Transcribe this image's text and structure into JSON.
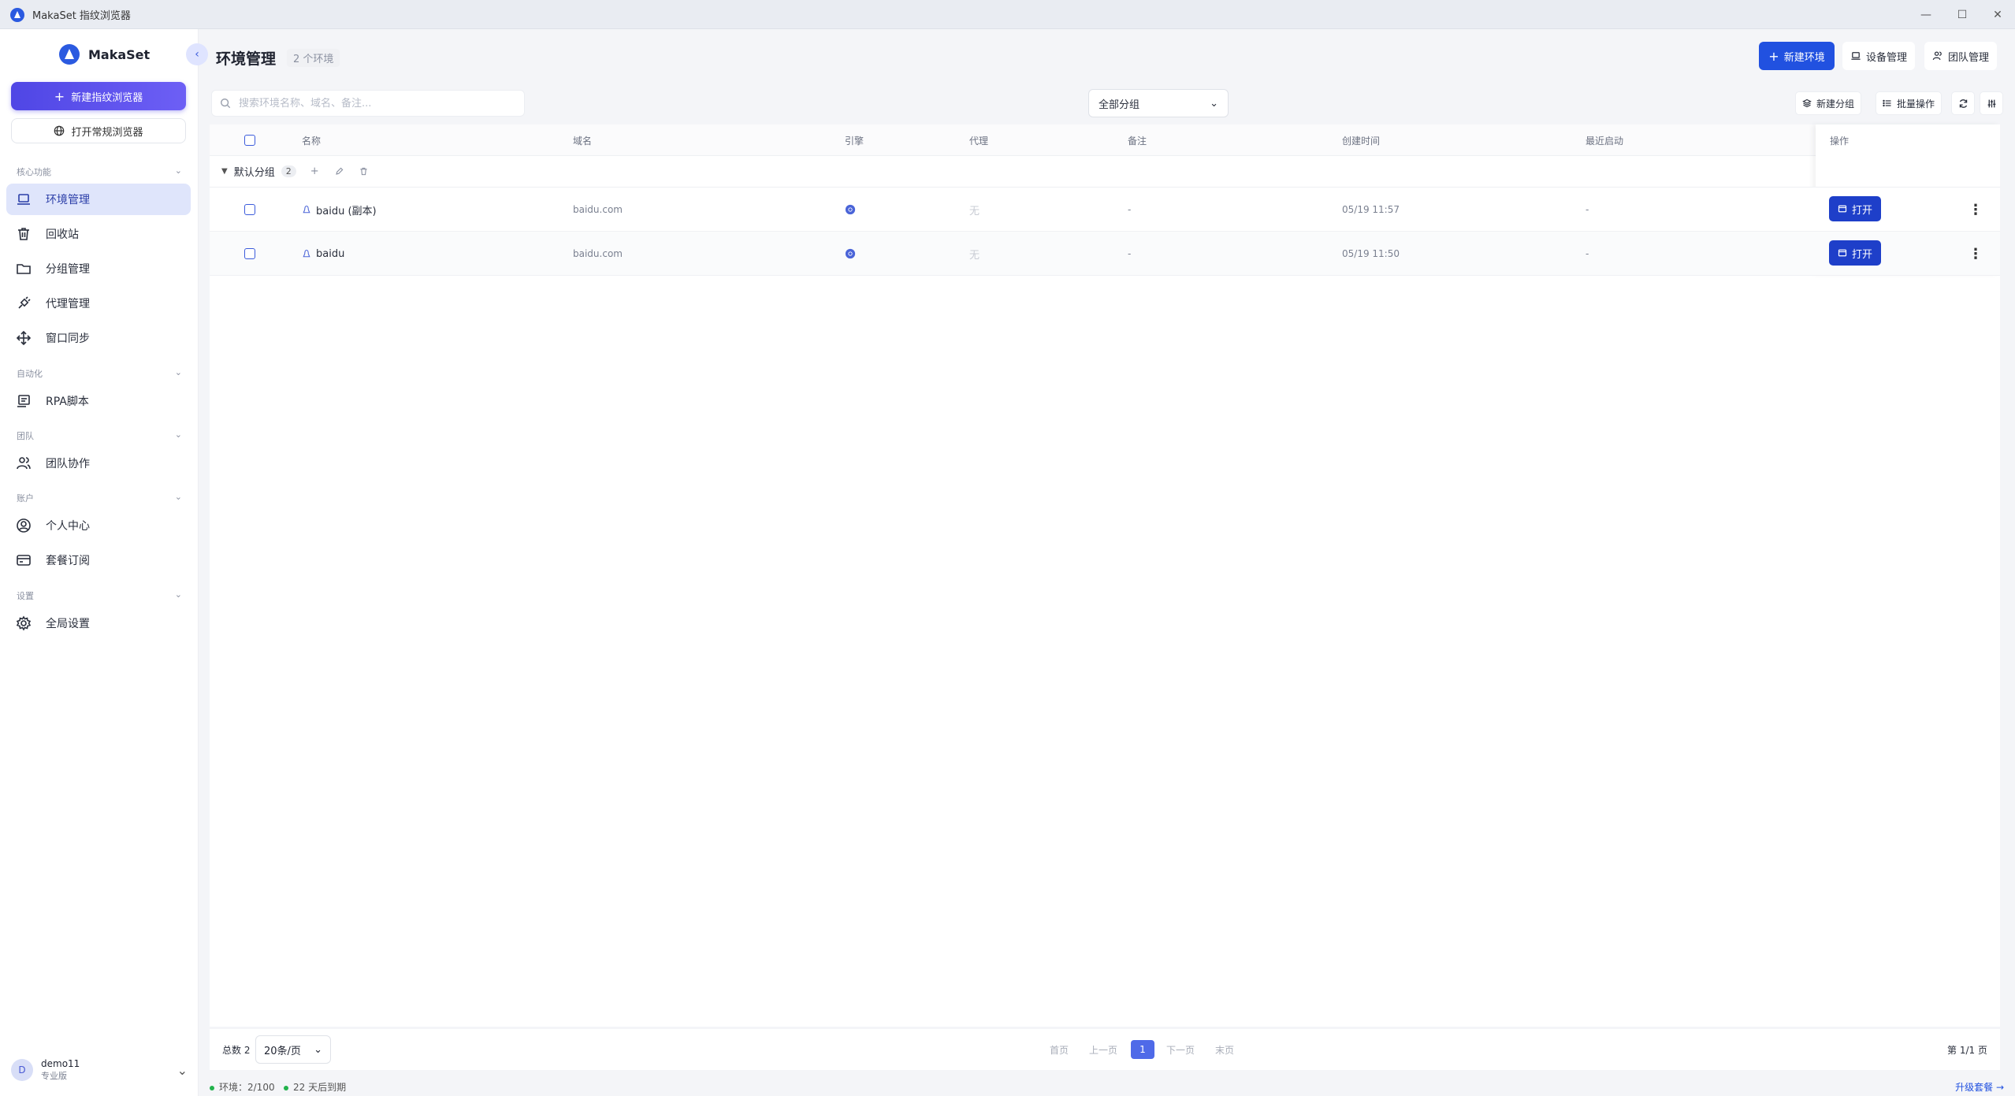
{
  "window": {
    "title": "MakaSet 指纹浏览器"
  },
  "sidebar": {
    "brand": "MakaSet",
    "new_browser_label": "新建指纹浏览器",
    "open_regular_label": "打开常规浏览器",
    "sections": {
      "core": "核心功能",
      "automation": "自动化",
      "team": "团队",
      "account": "账户",
      "settings": "设置"
    },
    "items": [
      {
        "label": "环境管理",
        "icon": "laptop-icon"
      },
      {
        "label": "回收站",
        "icon": "trash-icon"
      },
      {
        "label": "分组管理",
        "icon": "folder-icon"
      },
      {
        "label": "代理管理",
        "icon": "plug-icon"
      },
      {
        "label": "窗口同步",
        "icon": "move-icon"
      },
      {
        "label": "RPA脚本",
        "icon": "script-icon"
      },
      {
        "label": "团队协作",
        "icon": "users-icon"
      },
      {
        "label": "个人中心",
        "icon": "user-circle-icon"
      },
      {
        "label": "套餐订阅",
        "icon": "credit-card-icon"
      },
      {
        "label": "全局设置",
        "icon": "gear-icon"
      }
    ],
    "user": {
      "initial": "D",
      "name": "demo11",
      "plan": "专业版"
    }
  },
  "header": {
    "title": "环境管理",
    "count": "2 个环境",
    "new_env_label": "新建环境",
    "device_mgmt_label": "设备管理",
    "team_mgmt_label": "团队管理"
  },
  "toolbar": {
    "search_placeholder": "搜索环境名称、域名、备注...",
    "group_select": "全部分组",
    "new_group_label": "新建分组",
    "batch_label": "批量操作"
  },
  "table": {
    "columns": {
      "name": "名称",
      "domain": "域名",
      "engine": "引擎",
      "proxy": "代理",
      "remark": "备注",
      "created": "创建时间",
      "last_start": "最近启动",
      "action": "操作"
    },
    "group": {
      "name": "默认分组",
      "count": "2"
    },
    "rows": [
      {
        "name": "baidu (副本)",
        "domain": "baidu.com",
        "proxy": "无",
        "remark": "-",
        "created": "05/19 11:57",
        "last_start": "-",
        "open_label": "打开"
      },
      {
        "name": "baidu",
        "domain": "baidu.com",
        "proxy": "无",
        "remark": "-",
        "created": "05/19 11:50",
        "last_start": "-",
        "open_label": "打开"
      }
    ]
  },
  "pager": {
    "total": "总数 2",
    "page_size": "20条/页",
    "first": "首页",
    "prev": "上一页",
    "current": "1",
    "next": "下一页",
    "last": "末页",
    "info": "第 1/1 页"
  },
  "status": {
    "env_usage": "环境：2/100",
    "expiry": "22 天后到期",
    "upgrade": "升级套餐 →"
  },
  "colors": {
    "primary": "#2151e0",
    "accent": "#4f46e5",
    "active_bg": "#dfe5fb"
  }
}
